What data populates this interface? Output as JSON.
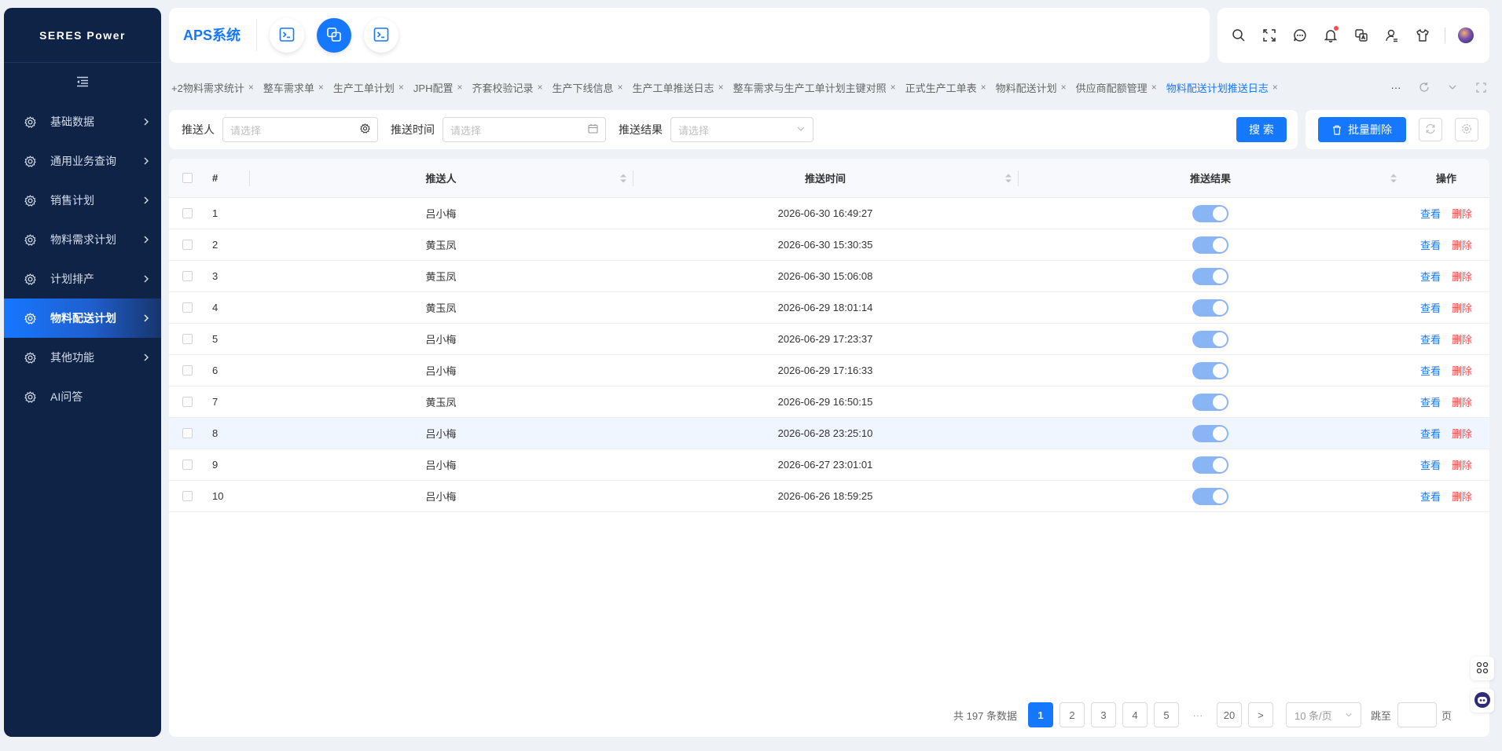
{
  "brand": "SERES Power",
  "app_title": "APS系统",
  "sidebar": {
    "items": [
      {
        "label": "基础数据",
        "active": false,
        "has_children": true
      },
      {
        "label": "通用业务查询",
        "active": false,
        "has_children": true
      },
      {
        "label": "销售计划",
        "active": false,
        "has_children": true
      },
      {
        "label": "物料需求计划",
        "active": false,
        "has_children": true
      },
      {
        "label": "计划排产",
        "active": false,
        "has_children": true
      },
      {
        "label": "物料配送计划",
        "active": true,
        "has_children": true
      },
      {
        "label": "其他功能",
        "active": false,
        "has_children": true
      },
      {
        "label": "AI问答",
        "active": false,
        "has_children": false
      }
    ]
  },
  "tabs": [
    {
      "label": "+2物料需求统计",
      "active": false
    },
    {
      "label": "整车需求单",
      "active": false
    },
    {
      "label": "生产工单计划",
      "active": false
    },
    {
      "label": "JPH配置",
      "active": false
    },
    {
      "label": "齐套校验记录",
      "active": false
    },
    {
      "label": "生产下线信息",
      "active": false
    },
    {
      "label": "生产工单推送日志",
      "active": false
    },
    {
      "label": "整车需求与生产工单计划主键对照",
      "active": false
    },
    {
      "label": "正式生产工单表",
      "active": false
    },
    {
      "label": "物料配送计划",
      "active": false
    },
    {
      "label": "供应商配额管理",
      "active": false
    },
    {
      "label": "物料配送计划推送日志",
      "active": true
    }
  ],
  "tabs_more": "···",
  "tab_close": "×",
  "filters": {
    "pusher_label": "推送人",
    "pusher_placeholder": "请选择",
    "time_label": "推送时间",
    "time_placeholder": "请选择",
    "result_label": "推送结果",
    "result_placeholder": "请选择",
    "search_button": "搜 索"
  },
  "actions": {
    "batch_delete": "批量删除"
  },
  "table": {
    "headers": {
      "index": "#",
      "pusher": "推送人",
      "time": "推送时间",
      "result": "推送结果",
      "ops": "操作"
    },
    "view_label": "查看",
    "delete_label": "删除",
    "rows": [
      {
        "index": "1",
        "pusher": "吕小梅",
        "time": "2026-06-30 16:49:27",
        "result_on": true
      },
      {
        "index": "2",
        "pusher": "黄玉凤",
        "time": "2026-06-30 15:30:35",
        "result_on": true
      },
      {
        "index": "3",
        "pusher": "黄玉凤",
        "time": "2026-06-30 15:06:08",
        "result_on": true
      },
      {
        "index": "4",
        "pusher": "黄玉凤",
        "time": "2026-06-29 18:01:14",
        "result_on": true
      },
      {
        "index": "5",
        "pusher": "吕小梅",
        "time": "2026-06-29 17:23:37",
        "result_on": true
      },
      {
        "index": "6",
        "pusher": "吕小梅",
        "time": "2026-06-29 17:16:33",
        "result_on": true
      },
      {
        "index": "7",
        "pusher": "黄玉凤",
        "time": "2026-06-29 16:50:15",
        "result_on": true
      },
      {
        "index": "8",
        "pusher": "吕小梅",
        "time": "2026-06-28 23:25:10",
        "result_on": true
      },
      {
        "index": "9",
        "pusher": "吕小梅",
        "time": "2026-06-27 23:01:01",
        "result_on": true
      },
      {
        "index": "10",
        "pusher": "吕小梅",
        "time": "2026-06-26 18:59:25",
        "result_on": true
      }
    ]
  },
  "pagination": {
    "total_text": "共 197 条数据",
    "pages": [
      "1",
      "2",
      "3",
      "4",
      "5"
    ],
    "current": "1",
    "ellipsis": "···",
    "last": "20",
    "next": ">",
    "page_size": "10 条/页",
    "jump_label": "跳至",
    "jump_suffix": "页"
  },
  "colors": {
    "primary": "#1677ff",
    "sidebar_bg": "#0f2347",
    "danger": "#ff4d4f"
  }
}
